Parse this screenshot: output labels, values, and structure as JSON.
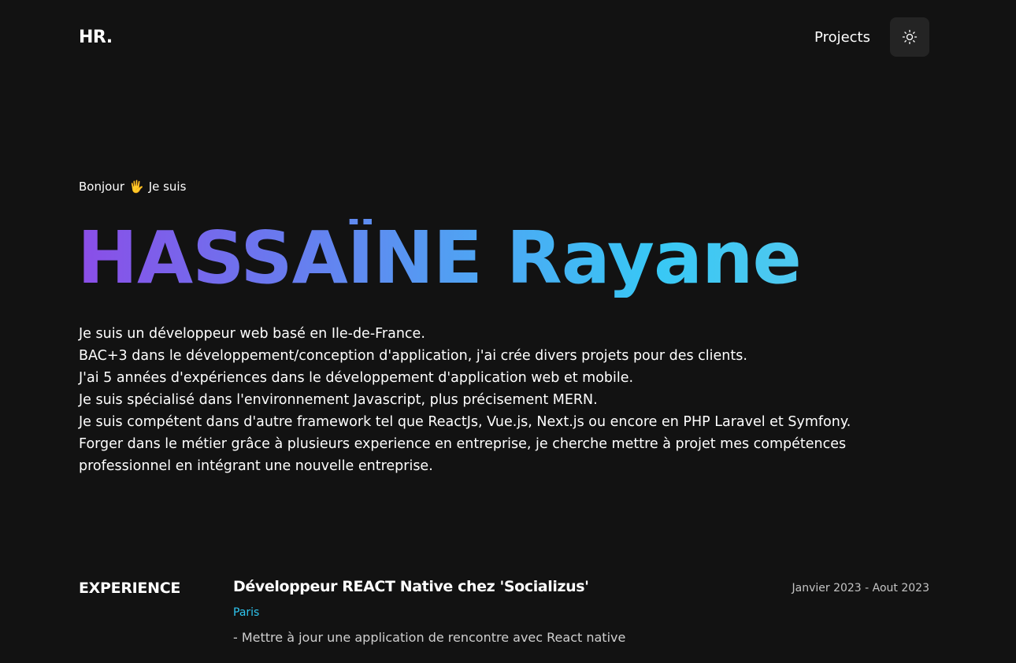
{
  "header": {
    "logo": "HR.",
    "nav": {
      "projects": "Projects"
    },
    "theme_toggle_icon": "sun-icon"
  },
  "hero": {
    "greeting_before": "Bonjour",
    "greeting_emoji": "🖐",
    "greeting_after": "Je suis",
    "name": "HASSAÏNE Rayane",
    "gradient_colors": [
      "#8b4de7",
      "#6c75ee",
      "#4fa4f3",
      "#38c8f5"
    ],
    "bio": [
      "Je suis un développeur web basé en Ile-de-France.",
      "BAC+3 dans le développement/conception d'application, j'ai crée divers projets pour des clients.",
      "J'ai 5 années d'expériences dans le développement d'application web et mobile.",
      "Je suis spécialisé dans l'environnement Javascript, plus précisement MERN.",
      "Je suis compétent dans d'autre framework tel que ReactJs, Vue.js, Next.js ou encore en PHP Laravel et Symfony.",
      "Forger dans le métier grâce à plusieurs experience en entreprise, je cherche mettre à projet mes compétences professionnel en intégrant une nouvelle entreprise."
    ]
  },
  "experience": {
    "section_title": "EXPERIENCE",
    "items": [
      {
        "role": "Développeur REACT Native chez 'Socializus'",
        "dates": "Janvier 2023 - Aout 2023",
        "location": "Paris",
        "description": "- Mettre à jour une application de rencontre avec React native"
      }
    ]
  },
  "colors": {
    "background": "#121212",
    "button_bg": "#242424",
    "accent": "#2ec6f0"
  }
}
